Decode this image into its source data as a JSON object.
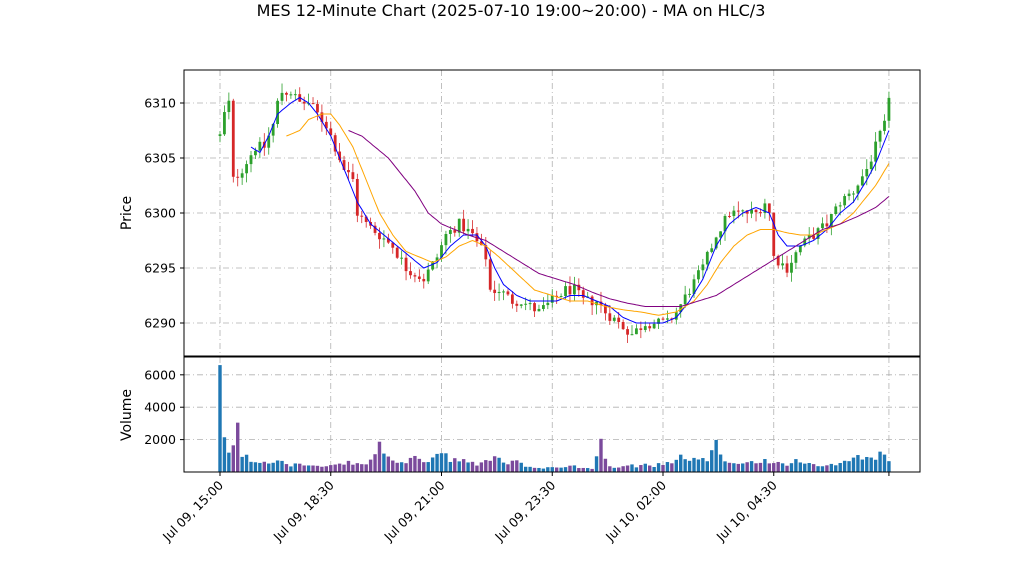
{
  "chart_data": {
    "type": "candlestick",
    "title": "MES 12-Minute Chart (2025-07-10 19:00~20:00) - MA on HLC/3",
    "price_panel": {
      "ylabel": "Price",
      "ylim": [
        6287,
        6313
      ],
      "yticks": [
        6290,
        6295,
        6300,
        6305,
        6310
      ],
      "grid": true
    },
    "volume_panel": {
      "ylabel": "Volume",
      "ylim": [
        0,
        7100
      ],
      "yticks": [
        2000,
        4000,
        6000
      ],
      "grid": true
    },
    "x_axis": {
      "tick_labels": [
        "Jul 09, 15:00",
        "Jul 09, 18:30",
        "Jul 09, 21:00",
        "Jul 09, 23:30",
        "Jul 10, 02:00",
        "Jul 10, 04:30"
      ],
      "tick_bar_index": [
        0,
        25,
        50,
        75,
        100,
        125
      ]
    },
    "colors": {
      "up": "#2ca02c",
      "down": "#d62728",
      "volume_up": "#1f77b4",
      "volume_down": "#7b4a9c",
      "ma_fast": "#0000ff",
      "ma_mid": "#ffa500",
      "ma_slow": "#800080",
      "grid": "#b0b0b0"
    },
    "series": [
      {
        "name": "price",
        "knots": [
          [
            0,
            6307
          ],
          [
            1,
            6309
          ],
          [
            2,
            6310
          ],
          [
            3,
            6303
          ],
          [
            5,
            6304
          ],
          [
            8,
            6306
          ],
          [
            10,
            6306
          ],
          [
            12,
            6308
          ],
          [
            13,
            6310
          ],
          [
            14,
            6311
          ],
          [
            15,
            6311
          ],
          [
            16,
            6311
          ],
          [
            18,
            6310
          ],
          [
            20,
            6310
          ],
          [
            22,
            6309
          ],
          [
            24,
            6308
          ],
          [
            26,
            6306
          ],
          [
            28,
            6304
          ],
          [
            30,
            6303
          ],
          [
            31,
            6300
          ],
          [
            33,
            6299
          ],
          [
            36,
            6298
          ],
          [
            39,
            6297
          ],
          [
            42,
            6295
          ],
          [
            46,
            6294
          ],
          [
            49,
            6296
          ],
          [
            51,
            6298
          ],
          [
            54,
            6299
          ],
          [
            57,
            6298
          ],
          [
            60,
            6296
          ],
          [
            61,
            6293
          ],
          [
            63,
            6293
          ],
          [
            66,
            6292
          ],
          [
            68,
            6292
          ],
          [
            72,
            6291
          ],
          [
            75,
            6292
          ],
          [
            78,
            6293
          ],
          [
            80,
            6293
          ],
          [
            82,
            6292
          ],
          [
            85,
            6292
          ],
          [
            87,
            6291
          ],
          [
            90,
            6290
          ],
          [
            93,
            6289
          ],
          [
            96,
            6290
          ],
          [
            99,
            6290
          ],
          [
            101,
            6290
          ],
          [
            103,
            6291
          ],
          [
            106,
            6293
          ],
          [
            109,
            6295
          ],
          [
            112,
            6298
          ],
          [
            115,
            6300
          ],
          [
            118,
            6300
          ],
          [
            121,
            6300
          ],
          [
            123,
            6301
          ],
          [
            124,
            6300
          ],
          [
            125,
            6296
          ],
          [
            128,
            6295
          ],
          [
            131,
            6297
          ],
          [
            134,
            6298
          ],
          [
            137,
            6299
          ],
          [
            140,
            6301
          ],
          [
            143,
            6302
          ],
          [
            146,
            6304
          ],
          [
            148,
            6306
          ],
          [
            150,
            6308
          ],
          [
            151,
            6310
          ]
        ],
        "approx_range": [
          6288,
          6312
        ]
      },
      {
        "name": "ma_fast",
        "knots": [
          [
            7,
            6306
          ],
          [
            9,
            6305.5
          ],
          [
            11,
            6307
          ],
          [
            13,
            6309
          ],
          [
            16,
            6310
          ],
          [
            18,
            6310.5
          ],
          [
            20,
            6310
          ],
          [
            22,
            6309
          ],
          [
            25,
            6307
          ],
          [
            28,
            6304
          ],
          [
            31,
            6301
          ],
          [
            34,
            6299
          ],
          [
            37,
            6298
          ],
          [
            40,
            6297
          ],
          [
            43,
            6296
          ],
          [
            46,
            6295
          ],
          [
            49,
            6295.5
          ],
          [
            52,
            6297
          ],
          [
            55,
            6298
          ],
          [
            58,
            6298
          ],
          [
            60,
            6297
          ],
          [
            62,
            6295
          ],
          [
            64,
            6293.5
          ],
          [
            67,
            6292.5
          ],
          [
            70,
            6292
          ],
          [
            73,
            6292
          ],
          [
            76,
            6292
          ],
          [
            79,
            6292.5
          ],
          [
            82,
            6292.5
          ],
          [
            85,
            6292
          ],
          [
            88,
            6291.5
          ],
          [
            91,
            6290.5
          ],
          [
            94,
            6290
          ],
          [
            97,
            6290
          ],
          [
            100,
            6290
          ],
          [
            103,
            6290.5
          ],
          [
            106,
            6292
          ],
          [
            109,
            6294
          ],
          [
            112,
            6297
          ],
          [
            115,
            6299
          ],
          [
            118,
            6300
          ],
          [
            121,
            6300.5
          ],
          [
            124,
            6300
          ],
          [
            126,
            6298
          ],
          [
            128,
            6297
          ],
          [
            131,
            6297
          ],
          [
            134,
            6297.5
          ],
          [
            137,
            6298.5
          ],
          [
            140,
            6300
          ],
          [
            143,
            6301
          ],
          [
            146,
            6303
          ],
          [
            148,
            6304.5
          ],
          [
            151,
            6307.5
          ]
        ]
      },
      {
        "name": "ma_mid",
        "knots": [
          [
            15,
            6307
          ],
          [
            18,
            6307.5
          ],
          [
            20,
            6308.5
          ],
          [
            23,
            6309
          ],
          [
            25,
            6309
          ],
          [
            27,
            6308
          ],
          [
            30,
            6306
          ],
          [
            33,
            6303
          ],
          [
            36,
            6300
          ],
          [
            39,
            6298
          ],
          [
            42,
            6296.5
          ],
          [
            45,
            6296
          ],
          [
            48,
            6295.5
          ],
          [
            51,
            6296
          ],
          [
            54,
            6297
          ],
          [
            57,
            6297.5
          ],
          [
            60,
            6297
          ],
          [
            63,
            6296
          ],
          [
            67,
            6294.5
          ],
          [
            71,
            6293
          ],
          [
            75,
            6292.5
          ],
          [
            79,
            6292
          ],
          [
            83,
            6292
          ],
          [
            87,
            6291.5
          ],
          [
            91,
            6291.2
          ],
          [
            95,
            6291
          ],
          [
            99,
            6290.7
          ],
          [
            103,
            6291
          ],
          [
            107,
            6292
          ],
          [
            110,
            6293.5
          ],
          [
            113,
            6295.5
          ],
          [
            116,
            6297
          ],
          [
            119,
            6298
          ],
          [
            122,
            6298.5
          ],
          [
            125,
            6298.5
          ],
          [
            128,
            6298.2
          ],
          [
            131,
            6298
          ],
          [
            134,
            6298
          ],
          [
            137,
            6298.5
          ],
          [
            140,
            6299
          ],
          [
            143,
            6300
          ],
          [
            146,
            6301.5
          ],
          [
            148,
            6302.5
          ],
          [
            151,
            6304.5
          ]
        ]
      },
      {
        "name": "ma_slow",
        "knots": [
          [
            29,
            6307.5
          ],
          [
            32,
            6307
          ],
          [
            35,
            6306
          ],
          [
            38,
            6305
          ],
          [
            41,
            6303.5
          ],
          [
            44,
            6302
          ],
          [
            47,
            6300
          ],
          [
            50,
            6299
          ],
          [
            53,
            6298.5
          ],
          [
            56,
            6298
          ],
          [
            60,
            6297.5
          ],
          [
            64,
            6296.5
          ],
          [
            68,
            6295.5
          ],
          [
            72,
            6294.5
          ],
          [
            76,
            6294
          ],
          [
            80,
            6293.5
          ],
          [
            84,
            6292.8
          ],
          [
            88,
            6292.2
          ],
          [
            92,
            6291.8
          ],
          [
            96,
            6291.5
          ],
          [
            100,
            6291.5
          ],
          [
            104,
            6291.5
          ],
          [
            108,
            6292
          ],
          [
            112,
            6292.5
          ],
          [
            116,
            6293.5
          ],
          [
            120,
            6294.5
          ],
          [
            124,
            6295.5
          ],
          [
            128,
            6296.5
          ],
          [
            132,
            6297.5
          ],
          [
            136,
            6298.5
          ],
          [
            140,
            6299
          ],
          [
            144,
            6299.7
          ],
          [
            148,
            6300.5
          ],
          [
            151,
            6301.5
          ]
        ]
      }
    ],
    "volume_knots": [
      [
        0,
        6600
      ],
      [
        1,
        1800
      ],
      [
        2,
        1300
      ],
      [
        3,
        1900
      ],
      [
        4,
        2600
      ],
      [
        5,
        1000
      ],
      [
        6,
        900
      ],
      [
        8,
        600
      ],
      [
        10,
        700
      ],
      [
        12,
        600
      ],
      [
        14,
        900
      ],
      [
        16,
        400
      ],
      [
        18,
        500
      ],
      [
        20,
        400
      ],
      [
        22,
        350
      ],
      [
        24,
        300
      ],
      [
        26,
        400
      ],
      [
        28,
        500
      ],
      [
        30,
        600
      ],
      [
        32,
        400
      ],
      [
        34,
        700
      ],
      [
        36,
        1700
      ],
      [
        38,
        800
      ],
      [
        40,
        700
      ],
      [
        42,
        600
      ],
      [
        44,
        800
      ],
      [
        46,
        600
      ],
      [
        48,
        900
      ],
      [
        50,
        1200
      ],
      [
        52,
        700
      ],
      [
        54,
        700
      ],
      [
        56,
        600
      ],
      [
        58,
        500
      ],
      [
        60,
        600
      ],
      [
        62,
        1100
      ],
      [
        64,
        500
      ],
      [
        66,
        700
      ],
      [
        68,
        500
      ],
      [
        70,
        300
      ],
      [
        72,
        200
      ],
      [
        74,
        300
      ],
      [
        76,
        250
      ],
      [
        78,
        400
      ],
      [
        80,
        350
      ],
      [
        82,
        250
      ],
      [
        84,
        200
      ],
      [
        86,
        1800
      ],
      [
        88,
        300
      ],
      [
        90,
        350
      ],
      [
        92,
        500
      ],
      [
        94,
        350
      ],
      [
        96,
        450
      ],
      [
        98,
        400
      ],
      [
        100,
        500
      ],
      [
        102,
        500
      ],
      [
        104,
        900
      ],
      [
        106,
        700
      ],
      [
        108,
        800
      ],
      [
        110,
        600
      ],
      [
        112,
        1700
      ],
      [
        114,
        700
      ],
      [
        116,
        500
      ],
      [
        118,
        600
      ],
      [
        120,
        600
      ],
      [
        122,
        700
      ],
      [
        124,
        700
      ],
      [
        126,
        500
      ],
      [
        128,
        400
      ],
      [
        130,
        800
      ],
      [
        132,
        500
      ],
      [
        134,
        450
      ],
      [
        136,
        300
      ],
      [
        138,
        400
      ],
      [
        140,
        600
      ],
      [
        142,
        700
      ],
      [
        144,
        900
      ],
      [
        146,
        800
      ],
      [
        148,
        1000
      ],
      [
        150,
        1200
      ],
      [
        151,
        600
      ]
    ]
  }
}
